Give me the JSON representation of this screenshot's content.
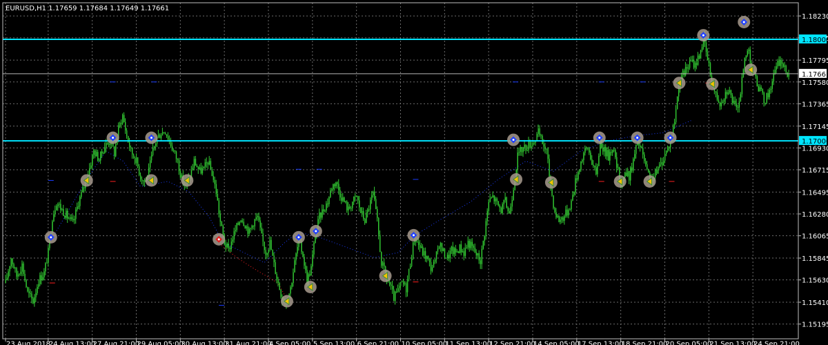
{
  "chart_data": {
    "type": "candlestick",
    "symbol_header": "EURUSD,H1  1.17659 1.17684 1.17649 1.17661",
    "ylim": [
      1.1505,
      1.1836
    ],
    "x_range": [
      0,
      1156
    ],
    "grid": true,
    "colors": {
      "background": "#000000",
      "grid": "#6e6e6e",
      "candles": "#33cc33",
      "frame": "#c0c0c0",
      "level_line": "#00e5ff",
      "current_line": "#b8b8b8",
      "blue_dots": "#1a3cff",
      "red_dots": "#ff2020",
      "marker_fill": "#a89b8e"
    },
    "y_ticks": [
      {
        "label": "1.18230",
        "value": 1.1823
      },
      {
        "label": "1.18015",
        "value": 1.18015
      },
      {
        "label": "1.17795",
        "value": 1.17795
      },
      {
        "label": "1.17580",
        "value": 1.1758
      },
      {
        "label": "1.17365",
        "value": 1.17365
      },
      {
        "label": "1.17145",
        "value": 1.17145
      },
      {
        "label": "1.16930",
        "value": 1.1693
      },
      {
        "label": "1.16715",
        "value": 1.16715
      },
      {
        "label": "1.16495",
        "value": 1.16495
      },
      {
        "label": "1.16280",
        "value": 1.1628
      },
      {
        "label": "1.16065",
        "value": 1.16065
      },
      {
        "label": "1.15845",
        "value": 1.15845
      },
      {
        "label": "1.15630",
        "value": 1.1563
      },
      {
        "label": "1.15410",
        "value": 1.1541
      },
      {
        "label": "1.15195",
        "value": 1.15195
      }
    ],
    "x_ticks": [
      {
        "label": "23 Aug 2018",
        "x": 4
      },
      {
        "label": "24 Aug 13:00",
        "x": 66
      },
      {
        "label": "27 Aug 21:00",
        "x": 130
      },
      {
        "label": "29 Aug 05:00",
        "x": 194
      },
      {
        "label": "30 Aug 13:00",
        "x": 258
      },
      {
        "label": "31 Aug 21:00",
        "x": 322
      },
      {
        "label": "4 Sep 05:00",
        "x": 386
      },
      {
        "label": "5 Sep 13:00",
        "x": 450
      },
      {
        "label": "6 Sep 21:00",
        "x": 514
      },
      {
        "label": "10 Sep 05:00",
        "x": 578
      },
      {
        "label": "11 Sep 13:00",
        "x": 642
      },
      {
        "label": "12 Sep 21:00",
        "x": 706
      },
      {
        "label": "14 Sep 05:00",
        "x": 770
      },
      {
        "label": "17 Sep 13:00",
        "x": 834
      },
      {
        "label": "18 Sep 21:00",
        "x": 898
      },
      {
        "label": "20 Sep 05:00",
        "x": 962
      },
      {
        "label": "21 Sep 13:00",
        "x": 1026
      },
      {
        "label": "24 Sep 21:00",
        "x": 1090
      }
    ],
    "price_levels": [
      {
        "label": "1.18000",
        "value": 1.18
      },
      {
        "label": "1.17000",
        "value": 1.17
      }
    ],
    "current_price": {
      "label": "1.17661",
      "value": 1.17661
    },
    "price_path": [
      [
        4,
        1.156
      ],
      [
        12,
        1.1585
      ],
      [
        20,
        1.1567
      ],
      [
        28,
        1.1578
      ],
      [
        36,
        1.155
      ],
      [
        44,
        1.1542
      ],
      [
        52,
        1.1563
      ],
      [
        60,
        1.157
      ],
      [
        66,
        1.159
      ],
      [
        72,
        1.1625
      ],
      [
        78,
        1.164
      ],
      [
        86,
        1.1632
      ],
      [
        94,
        1.1625
      ],
      [
        102,
        1.1618
      ],
      [
        110,
        1.164
      ],
      [
        118,
        1.1655
      ],
      [
        124,
        1.1668
      ],
      [
        132,
        1.169
      ],
      [
        140,
        1.1682
      ],
      [
        148,
        1.1695
      ],
      [
        156,
        1.17
      ],
      [
        162,
        1.1688
      ],
      [
        168,
        1.1712
      ],
      [
        174,
        1.1725
      ],
      [
        180,
        1.1705
      ],
      [
        186,
        1.169
      ],
      [
        194,
        1.168
      ],
      [
        200,
        1.1665
      ],
      [
        206,
        1.166
      ],
      [
        212,
        1.167
      ],
      [
        218,
        1.169
      ],
      [
        224,
        1.1703
      ],
      [
        230,
        1.1708
      ],
      [
        236,
        1.171
      ],
      [
        242,
        1.17
      ],
      [
        248,
        1.169
      ],
      [
        254,
        1.168
      ],
      [
        260,
        1.1662
      ],
      [
        266,
        1.1655
      ],
      [
        272,
        1.1665
      ],
      [
        278,
        1.168
      ],
      [
        286,
        1.167
      ],
      [
        292,
        1.1672
      ],
      [
        298,
        1.168
      ],
      [
        304,
        1.1668
      ],
      [
        310,
        1.165
      ],
      [
        316,
        1.162
      ],
      [
        322,
        1.16
      ],
      [
        328,
        1.1592
      ],
      [
        334,
        1.1605
      ],
      [
        340,
        1.1615
      ],
      [
        346,
        1.1625
      ],
      [
        352,
        1.1618
      ],
      [
        358,
        1.161
      ],
      [
        364,
        1.162
      ],
      [
        370,
        1.1625
      ],
      [
        376,
        1.1605
      ],
      [
        382,
        1.159
      ],
      [
        388,
        1.16
      ],
      [
        394,
        1.1578
      ],
      [
        400,
        1.156
      ],
      [
        406,
        1.1545
      ],
      [
        412,
        1.1542
      ],
      [
        418,
        1.1555
      ],
      [
        424,
        1.158
      ],
      [
        430,
        1.1602
      ],
      [
        436,
        1.1588
      ],
      [
        442,
        1.1562
      ],
      [
        448,
        1.1575
      ],
      [
        454,
        1.1608
      ],
      [
        460,
        1.1625
      ],
      [
        466,
        1.1633
      ],
      [
        472,
        1.164
      ],
      [
        478,
        1.1655
      ],
      [
        484,
        1.166
      ],
      [
        490,
        1.1648
      ],
      [
        496,
        1.164
      ],
      [
        502,
        1.1632
      ],
      [
        508,
        1.164
      ],
      [
        514,
        1.1645
      ],
      [
        520,
        1.163
      ],
      [
        526,
        1.1622
      ],
      [
        532,
        1.1635
      ],
      [
        538,
        1.1648
      ],
      [
        544,
        1.162
      ],
      [
        550,
        1.158
      ],
      [
        556,
        1.1568
      ],
      [
        562,
        1.1558
      ],
      [
        568,
        1.1545
      ],
      [
        574,
        1.1552
      ],
      [
        580,
        1.156
      ],
      [
        586,
        1.1555
      ],
      [
        592,
        1.158
      ],
      [
        598,
        1.1605
      ],
      [
        604,
        1.1598
      ],
      [
        610,
        1.159
      ],
      [
        616,
        1.1585
      ],
      [
        622,
        1.1575
      ],
      [
        628,
        1.158
      ],
      [
        634,
        1.16
      ],
      [
        640,
        1.159
      ],
      [
        646,
        1.1585
      ],
      [
        652,
        1.1592
      ],
      [
        658,
        1.159
      ],
      [
        664,
        1.1595
      ],
      [
        670,
        1.159
      ],
      [
        676,
        1.16
      ],
      [
        682,
        1.1595
      ],
      [
        688,
        1.1588
      ],
      [
        694,
        1.1582
      ],
      [
        700,
        1.161
      ],
      [
        706,
        1.164
      ],
      [
        712,
        1.1645
      ],
      [
        718,
        1.1638
      ],
      [
        724,
        1.1632
      ],
      [
        730,
        1.164
      ],
      [
        736,
        1.1628
      ],
      [
        742,
        1.1655
      ],
      [
        748,
        1.1685
      ],
      [
        754,
        1.1692
      ],
      [
        760,
        1.1694
      ],
      [
        766,
        1.1697
      ],
      [
        772,
        1.17
      ],
      [
        778,
        1.1708
      ],
      [
        784,
        1.1698
      ],
      [
        790,
        1.169
      ],
      [
        796,
        1.1655
      ],
      [
        802,
        1.163
      ],
      [
        808,
        1.1622
      ],
      [
        814,
        1.1625
      ],
      [
        820,
        1.163
      ],
      [
        826,
        1.164
      ],
      [
        832,
        1.166
      ],
      [
        838,
        1.1675
      ],
      [
        844,
        1.1688
      ],
      [
        850,
        1.1693
      ],
      [
        856,
        1.168
      ],
      [
        862,
        1.1665
      ],
      [
        868,
        1.17
      ],
      [
        874,
        1.169
      ],
      [
        880,
        1.1685
      ],
      [
        886,
        1.1695
      ],
      [
        892,
        1.1675
      ],
      [
        898,
        1.1658
      ],
      [
        904,
        1.1668
      ],
      [
        910,
        1.1665
      ],
      [
        916,
        1.168
      ],
      [
        922,
        1.17
      ],
      [
        928,
        1.169
      ],
      [
        934,
        1.1675
      ],
      [
        940,
        1.166
      ],
      [
        946,
        1.1665
      ],
      [
        952,
        1.1672
      ],
      [
        958,
        1.168
      ],
      [
        964,
        1.169
      ],
      [
        970,
        1.17
      ],
      [
        976,
        1.172
      ],
      [
        982,
        1.1755
      ],
      [
        988,
        1.1765
      ],
      [
        994,
        1.1772
      ],
      [
        1000,
        1.1778
      ],
      [
        1006,
        1.1775
      ],
      [
        1012,
        1.1785
      ],
      [
        1018,
        1.18
      ],
      [
        1024,
        1.178
      ],
      [
        1030,
        1.176
      ],
      [
        1036,
        1.1745
      ],
      [
        1042,
        1.1738
      ],
      [
        1048,
        1.1745
      ],
      [
        1054,
        1.1752
      ],
      [
        1060,
        1.174
      ],
      [
        1066,
        1.173
      ],
      [
        1072,
        1.1748
      ],
      [
        1078,
        1.178
      ],
      [
        1084,
        1.1792
      ],
      [
        1088,
        1.177
      ],
      [
        1094,
        1.176
      ],
      [
        1100,
        1.175
      ],
      [
        1106,
        1.174
      ],
      [
        1112,
        1.1745
      ],
      [
        1118,
        1.176
      ],
      [
        1124,
        1.1772
      ],
      [
        1130,
        1.178
      ],
      [
        1136,
        1.177
      ],
      [
        1142,
        1.1766
      ]
    ],
    "markers": [
      {
        "x": 70,
        "value": 1.1605,
        "kind": "blue"
      },
      {
        "x": 122,
        "value": 1.1661,
        "kind": "arrow"
      },
      {
        "x": 160,
        "value": 1.1703,
        "kind": "blue"
      },
      {
        "x": 216,
        "value": 1.1703,
        "kind": "blue"
      },
      {
        "x": 216,
        "value": 1.1661,
        "kind": "arrow"
      },
      {
        "x": 268,
        "value": 1.1661,
        "kind": "arrow"
      },
      {
        "x": 314,
        "value": 1.1603,
        "kind": "red"
      },
      {
        "x": 430,
        "value": 1.1605,
        "kind": "blue"
      },
      {
        "x": 455,
        "value": 1.1611,
        "kind": "blue"
      },
      {
        "x": 413,
        "value": 1.1542,
        "kind": "arrow"
      },
      {
        "x": 447,
        "value": 1.1556,
        "kind": "arrow"
      },
      {
        "x": 556,
        "value": 1.1567,
        "kind": "arrow"
      },
      {
        "x": 597,
        "value": 1.1607,
        "kind": "blue"
      },
      {
        "x": 742,
        "value": 1.1701,
        "kind": "blue"
      },
      {
        "x": 746,
        "value": 1.1662,
        "kind": "arrow"
      },
      {
        "x": 797,
        "value": 1.1659,
        "kind": "arrow"
      },
      {
        "x": 867,
        "value": 1.1703,
        "kind": "blue"
      },
      {
        "x": 897,
        "value": 1.166,
        "kind": "arrow"
      },
      {
        "x": 922,
        "value": 1.1703,
        "kind": "blue"
      },
      {
        "x": 940,
        "value": 1.166,
        "kind": "arrow"
      },
      {
        "x": 970,
        "value": 1.1703,
        "kind": "blue"
      },
      {
        "x": 983,
        "value": 1.1757,
        "kind": "arrow"
      },
      {
        "x": 1018,
        "value": 1.1804,
        "kind": "blue"
      },
      {
        "x": 1031,
        "value": 1.1756,
        "kind": "arrow"
      },
      {
        "x": 1077,
        "value": 1.1817,
        "kind": "blue"
      },
      {
        "x": 1087,
        "value": 1.177,
        "kind": "arrow"
      }
    ],
    "blue_dot_path": [
      [
        70,
        1.1602
      ],
      [
        90,
        1.1625
      ],
      [
        120,
        1.166
      ],
      [
        150,
        1.169
      ],
      [
        175,
        1.168
      ],
      [
        200,
        1.1655
      ],
      [
        240,
        1.166
      ],
      [
        270,
        1.165
      ],
      [
        300,
        1.1625
      ],
      [
        320,
        1.16
      ],
      [
        350,
        1.159
      ],
      [
        380,
        1.158
      ],
      [
        410,
        1.16
      ],
      [
        430,
        1.161
      ],
      [
        460,
        1.1605
      ],
      [
        500,
        1.1595
      ],
      [
        540,
        1.1585
      ],
      [
        575,
        1.159
      ],
      [
        597,
        1.1606
      ],
      [
        630,
        1.162
      ],
      [
        680,
        1.164
      ],
      [
        720,
        1.1662
      ],
      [
        760,
        1.168
      ],
      [
        800,
        1.167
      ],
      [
        840,
        1.169
      ],
      [
        880,
        1.17
      ],
      [
        920,
        1.1705
      ],
      [
        960,
        1.1708
      ],
      [
        1000,
        1.172
      ]
    ],
    "red_dot_path": [
      [
        318,
        1.1597
      ],
      [
        340,
        1.1585
      ],
      [
        370,
        1.1572
      ],
      [
        400,
        1.156
      ],
      [
        412,
        1.1545
      ]
    ],
    "dashes": [
      {
        "x": 70,
        "value": 1.1661,
        "kind": "blue"
      },
      {
        "x": 160,
        "value": 1.166,
        "kind": "red"
      },
      {
        "x": 160,
        "value": 1.1758,
        "kind": "blue"
      },
      {
        "x": 220,
        "value": 1.1758,
        "kind": "blue"
      },
      {
        "x": 72,
        "value": 1.156,
        "kind": "red"
      },
      {
        "x": 318,
        "value": 1.1538,
        "kind": "blue"
      },
      {
        "x": 430,
        "value": 1.1672,
        "kind": "blue"
      },
      {
        "x": 460,
        "value": 1.1672,
        "kind": "blue"
      },
      {
        "x": 600,
        "value": 1.1662,
        "kind": "blue"
      },
      {
        "x": 600,
        "value": 1.1561,
        "kind": "red"
      },
      {
        "x": 745,
        "value": 1.1758,
        "kind": "blue"
      },
      {
        "x": 870,
        "value": 1.166,
        "kind": "red"
      },
      {
        "x": 870,
        "value": 1.1758,
        "kind": "blue"
      },
      {
        "x": 930,
        "value": 1.1758,
        "kind": "blue"
      },
      {
        "x": 972,
        "value": 1.166,
        "kind": "red"
      },
      {
        "x": 1025,
        "value": 1.1757,
        "kind": "red"
      }
    ]
  }
}
